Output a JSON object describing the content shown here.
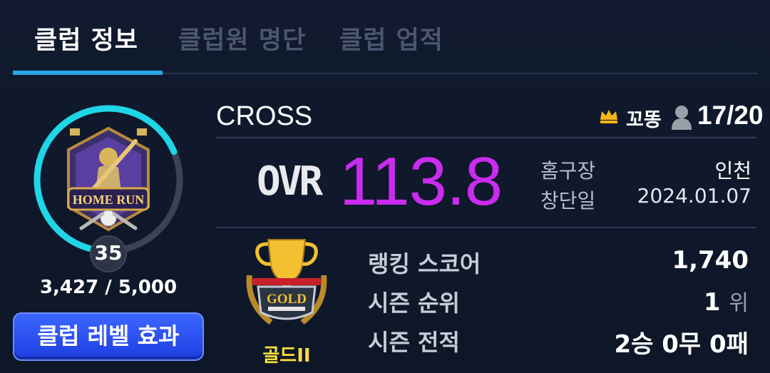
{
  "tabs": [
    {
      "label": "클럽 정보",
      "active": true
    },
    {
      "label": "클럽원 명단",
      "active": false
    },
    {
      "label": "클럽 업적",
      "active": false
    }
  ],
  "emblem": {
    "text": "HOME RUN",
    "level": "35",
    "exp_text": "3,427 / 5,000",
    "exp_progress": 0.6854
  },
  "level_button": "클럽 레벨 효과",
  "club": {
    "name": "CROSS",
    "owner": "꼬똥",
    "members": "17/20"
  },
  "ovr": {
    "label": "OVR",
    "value": "113.8"
  },
  "info": {
    "home_label": "홈구장",
    "home_value": "인천",
    "founded_label": "창단일",
    "founded_value": "2024.01.07"
  },
  "grade": {
    "badge_text": "GOLD",
    "name": "골드II"
  },
  "stats": {
    "ranking_label": "랭킹 스코어",
    "ranking_value": "1,740",
    "season_rank_label": "시즌 순위",
    "season_rank_value": "1",
    "season_rank_unit": "위",
    "season_record_label": "시즌 전적",
    "season_record_value": "2승 0무 0패"
  },
  "colors": {
    "accent": "#29a6e8",
    "ovr": "#cb2bf0",
    "gold": "#ffde3c",
    "exp_ring": "#1ed6e6",
    "button": "#2f54f2"
  },
  "icons": [
    "crown-icon",
    "member-icon",
    "home-run-emblem",
    "gold-trophy-emblem"
  ]
}
